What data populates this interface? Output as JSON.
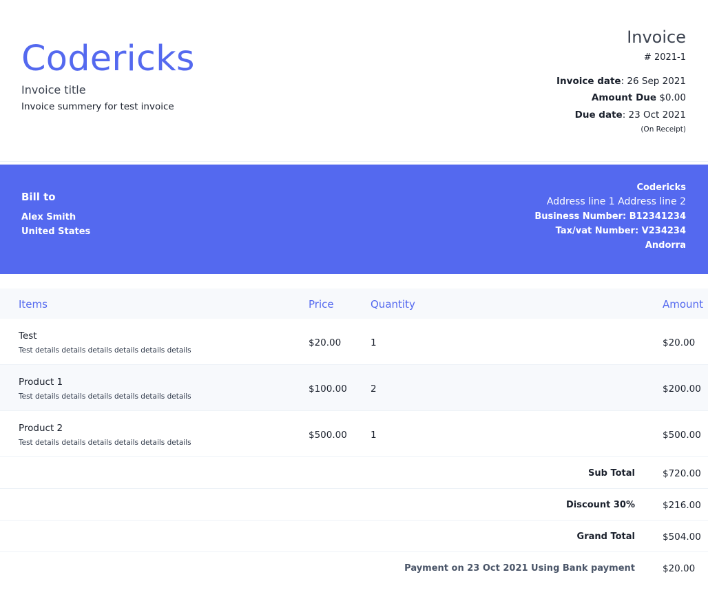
{
  "brand": {
    "name": "Codericks"
  },
  "invoice": {
    "title": "Invoice title",
    "summary": "Invoice summery for test invoice",
    "heading": "Invoice",
    "number": "# 2021-1",
    "date_label": "Invoice date",
    "date_value": ": 26 Sep 2021",
    "amount_due_label": "Amount Due",
    "amount_due_value": " $0.00",
    "due_date_label": "Due date",
    "due_date_value": ": 23 Oct 2021",
    "due_note": "(On Receipt)"
  },
  "bill_to": {
    "label": "Bill to",
    "name": "Alex Smith",
    "country": "United States"
  },
  "from": {
    "name": "Codericks",
    "address": "Address line 1 Address line 2",
    "business_number": "Business Number: B12341234",
    "tax_number": "Tax/vat Number: V234234",
    "country": "Andorra"
  },
  "table": {
    "headers": {
      "items": "Items",
      "price": "Price",
      "quantity": "Quantity",
      "amount": "Amount"
    },
    "rows": [
      {
        "name": "Test",
        "details": "Test details details details details details details",
        "price": "$20.00",
        "quantity": "1",
        "amount": "$20.00"
      },
      {
        "name": "Product 1",
        "details": "Test details details details details details details",
        "price": "$100.00",
        "quantity": "2",
        "amount": "$200.00"
      },
      {
        "name": "Product 2",
        "details": "Test details details details details details details",
        "price": "$500.00",
        "quantity": "1",
        "amount": "$500.00"
      }
    ]
  },
  "totals": {
    "subtotal_label": "Sub Total",
    "subtotal_value": "$720.00",
    "discount_label": "Discount 30%",
    "discount_value": "$216.00",
    "grand_total_label": "Grand Total",
    "grand_total_value": "$504.00",
    "payment_label": "Payment on 23 Oct 2021 Using Bank payment",
    "payment_value": "$20.00"
  },
  "colors": {
    "accent": "#5469ef",
    "row_alt": "#f7f9fc"
  }
}
